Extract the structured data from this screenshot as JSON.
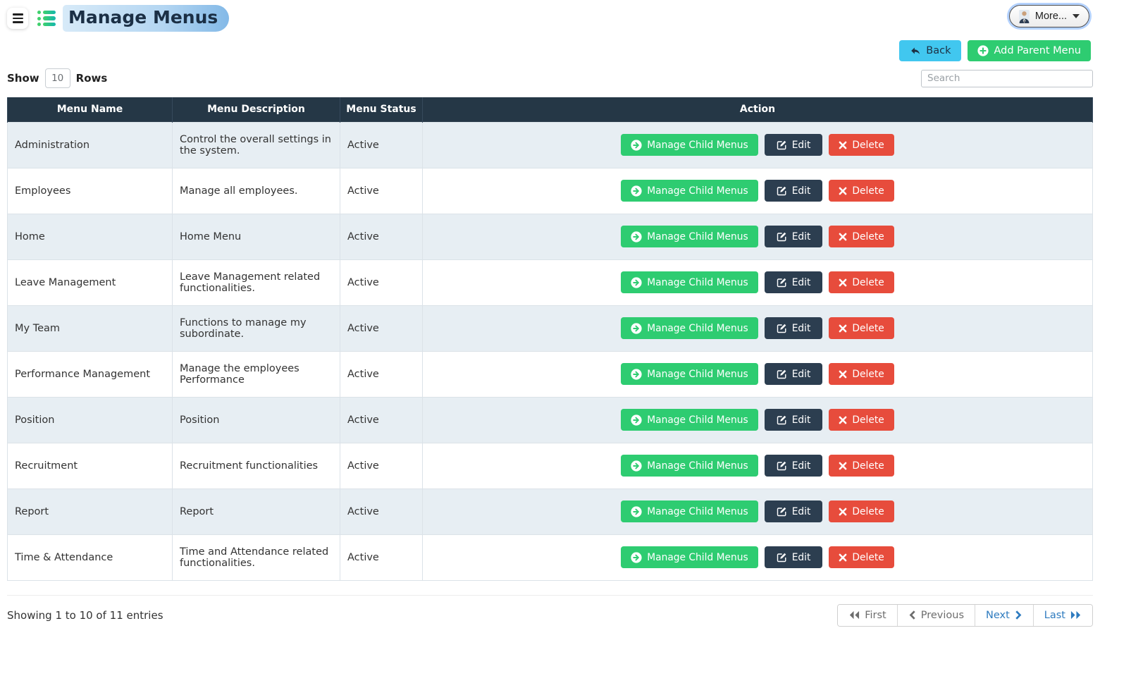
{
  "header": {
    "title": "Manage Menus",
    "more_button": "More..."
  },
  "toolbar": {
    "back": "Back",
    "add_parent": "Add Parent Menu"
  },
  "controls": {
    "show": "Show",
    "rows": "Rows",
    "rows_value": "10",
    "search_placeholder": "Search"
  },
  "table": {
    "columns": [
      "Menu Name",
      "Menu Description",
      "Menu Status",
      "Action"
    ],
    "actions": {
      "manage": "Manage Child Menus",
      "edit": "Edit",
      "delete": "Delete"
    },
    "rows": [
      {
        "name": "Administration",
        "description": "Control the overall settings in the system.",
        "status": "Active"
      },
      {
        "name": "Employees",
        "description": "Manage all employees.",
        "status": "Active"
      },
      {
        "name": "Home",
        "description": "Home Menu",
        "status": "Active"
      },
      {
        "name": "Leave Management",
        "description": "Leave Management related functionalities.",
        "status": "Active"
      },
      {
        "name": "My Team",
        "description": "Functions to manage my subordinate.",
        "status": "Active"
      },
      {
        "name": "Performance Management",
        "description": "Manage the employees Performance",
        "status": "Active"
      },
      {
        "name": "Position",
        "description": "Position",
        "status": "Active"
      },
      {
        "name": "Recruitment",
        "description": "Recruitment functionalities",
        "status": "Active"
      },
      {
        "name": "Report",
        "description": "Report",
        "status": "Active"
      },
      {
        "name": "Time & Attendance",
        "description": "Time and Attendance related functionalities.",
        "status": "Active"
      }
    ]
  },
  "footer": {
    "summary": "Showing 1 to 10 of 11 entries",
    "pagination": [
      {
        "label": "First",
        "enabled": false
      },
      {
        "label": "Previous",
        "enabled": false
      },
      {
        "label": "Next",
        "enabled": true
      },
      {
        "label": "Last",
        "enabled": true
      }
    ]
  },
  "colors": {
    "table_header": "#253746",
    "row_alt": "#e7eef3",
    "green": "#2ecc71",
    "red": "#e74c3c",
    "navy": "#2c3e50",
    "cyan": "#41c7ef",
    "link_blue": "#2e7bbf",
    "title_highlight": "#9cc8ef"
  }
}
